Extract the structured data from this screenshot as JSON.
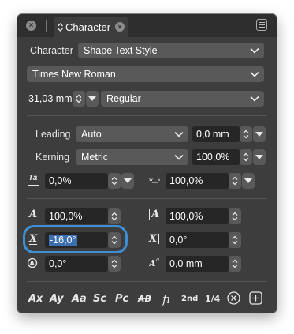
{
  "tab": {
    "title": "Character"
  },
  "row1": {
    "label": "Character",
    "value": "Shape Text Style"
  },
  "font": {
    "family": "Times New Roman",
    "size": "31,03 mm",
    "style": "Regular"
  },
  "leading": {
    "label": "Leading",
    "mode": "Auto",
    "value": "0,0 mm"
  },
  "kerning": {
    "label": "Kerning",
    "mode": "Metric",
    "value": "100,0%"
  },
  "tracking": {
    "value": "0,0%"
  },
  "word_spacing": {
    "value": "100,0%"
  },
  "scale_x": {
    "value": "100,0%"
  },
  "scale_y": {
    "value": "100,0%"
  },
  "shear": {
    "value": "-16,0°"
  },
  "rotation": {
    "value": "0,0°"
  },
  "rotate_char": {
    "value": "0,0°"
  },
  "baseline": {
    "value": "0,0 mm"
  },
  "bottom": {
    "ax": "Ax",
    "ay": "Ay",
    "aa": "Aa",
    "sc": "Sc",
    "pc": "Pc",
    "ab": "AB",
    "fi": "fi",
    "nd": "2nd",
    "frac": "1/4"
  },
  "colors": {
    "panel": "#3d3d3d",
    "field": "#262626",
    "control": "#595959",
    "focus": "#3d8fd6"
  }
}
